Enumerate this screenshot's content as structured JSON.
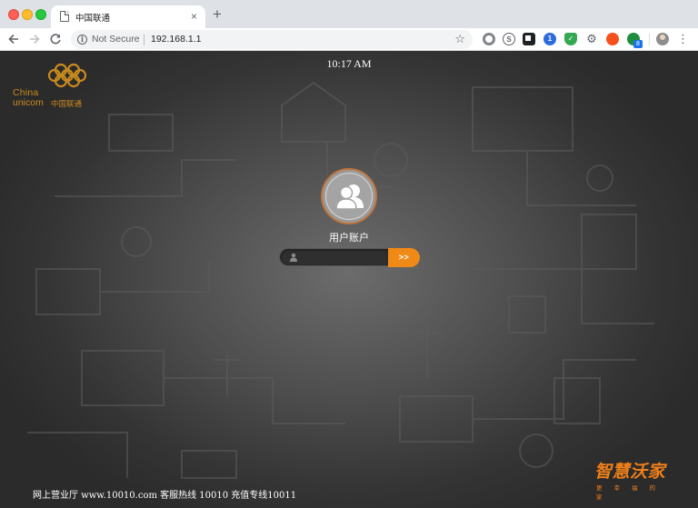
{
  "browser": {
    "tab_title": "中国联通",
    "tab_close": "×",
    "new_tab": "+",
    "security_label": "Not Secure",
    "url": "192.168.1.1",
    "extension_badge": "8",
    "icons": [
      "page-icon",
      "back-arrow-icon",
      "forward-arrow-icon",
      "reload-icon",
      "info-icon",
      "star-icon",
      "menu-icon"
    ]
  },
  "page": {
    "logo": {
      "latin_1": "China",
      "latin_2": "unicom",
      "chinese": "中国联通"
    },
    "clock": "10:17 AM",
    "account_label": "用户账户",
    "login_input": {
      "value": "",
      "placeholder": ""
    },
    "go_button": ">>",
    "footer": "网上营业厅 www.10010.com 客服热线 10010 充值专线10011",
    "brand": {
      "main": "智慧沃家",
      "tagline": "更幸福的家"
    },
    "colors": {
      "accent": "#ef8a17",
      "logo": "#c98a1e"
    }
  }
}
